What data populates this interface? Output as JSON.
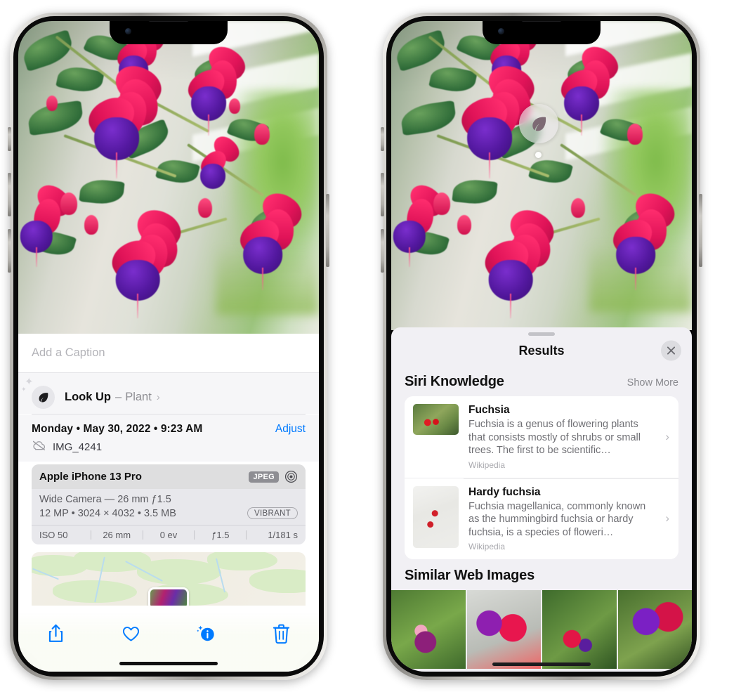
{
  "left_phone": {
    "photo_alt": "fuchsia-flowers-photo",
    "caption": {
      "placeholder": "Add a Caption",
      "value": ""
    },
    "look_up": {
      "icon": "leaf-icon",
      "sparkle_icon": "sparkles-icon",
      "title": "Look Up",
      "dash": "–",
      "subject": "Plant",
      "chevron": "›"
    },
    "metadata": {
      "date_line": "Monday • May 30, 2022 • 9:23 AM",
      "adjust_label": "Adjust",
      "cloud_icon": "cloud-slash-icon",
      "filename": "IMG_4241"
    },
    "exif": {
      "device": "Apple iPhone 13 Pro",
      "format_tag": "JPEG",
      "aperture_icon": "aperture-icon",
      "lens": "Wide Camera — 26 mm ƒ1.5",
      "size_line": "12 MP • 3024 × 4032 • 3.5 MB",
      "style_tag": "VIBRANT",
      "stats": [
        "ISO 50",
        "26 mm",
        "0 ev",
        "ƒ1.5",
        "1/181 s"
      ]
    },
    "map": {
      "name": "location-map-card",
      "pin_thumbnail": "photo-pin-thumbnail"
    },
    "toolbar": [
      {
        "name": "share-button",
        "icon": "share-icon",
        "active": false
      },
      {
        "name": "favorite-button",
        "icon": "heart-icon",
        "active": false
      },
      {
        "name": "info-button",
        "icon": "info-sparkle-icon",
        "active": true
      },
      {
        "name": "delete-button",
        "icon": "trash-icon",
        "active": false
      }
    ],
    "accent_color": "#007aff"
  },
  "right_phone": {
    "visual_lookup_badge": {
      "icon": "leaf-icon",
      "indicator": "lookup-dot"
    },
    "sheet": {
      "grabber": "sheet-grabber",
      "title": "Results",
      "close_icon": "close-icon"
    },
    "siri_knowledge": {
      "section_title": "Siri Knowledge",
      "show_more": "Show More",
      "results": [
        {
          "title": "Fuchsia",
          "description": "Fuchsia is a genus of flowering plants that consists mostly of shrubs or small trees. The first to be scientific…",
          "source": "Wikipedia",
          "thumbnail": "fuchsia-thumbnail",
          "chevron": "›"
        },
        {
          "title": "Hardy fuchsia",
          "description": "Fuchsia magellanica, commonly known as the hummingbird fuchsia or hardy fuchsia, is a species of floweri…",
          "source": "Wikipedia",
          "thumbnail": "hardy-fuchsia-thumbnail",
          "chevron": "›"
        }
      ]
    },
    "similar_web_images": {
      "section_title": "Similar Web Images",
      "thumbnails": [
        "web-image-1",
        "web-image-2",
        "web-image-3",
        "web-image-4"
      ]
    }
  }
}
